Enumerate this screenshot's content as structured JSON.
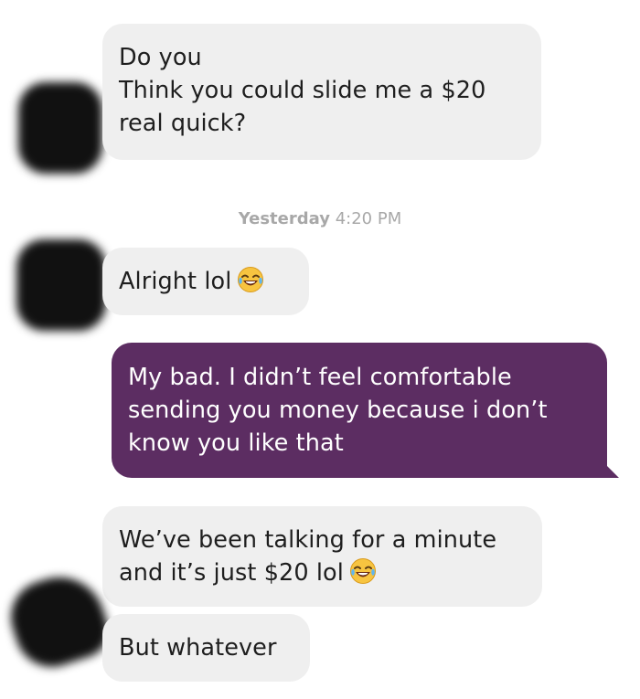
{
  "conversation": {
    "messages": [
      {
        "direction": "received",
        "lines": [
          "Do you",
          "Think you could slide me a $20",
          "real quick?"
        ]
      },
      {
        "direction": "received",
        "text": "Alright lol",
        "emoji": "face-with-tears-of-joy-icon"
      },
      {
        "direction": "sent",
        "lines": [
          "My bad. I didn’t feel comfortable",
          "sending you money because i don’t",
          "know you like that"
        ]
      },
      {
        "direction": "received",
        "lines": [
          "We’ve been talking for a minute",
          "and it’s just $20 lol"
        ],
        "emoji": "face-with-tears-of-joy-icon"
      },
      {
        "direction": "received",
        "text": "But whatever"
      }
    ],
    "timestamp": {
      "day": "Yesterday",
      "time": "4:20 PM"
    }
  },
  "colors": {
    "received_bubble": "#efefef",
    "sent_bubble": "#5c2d62",
    "timestamp_text": "#a8a8a8"
  }
}
